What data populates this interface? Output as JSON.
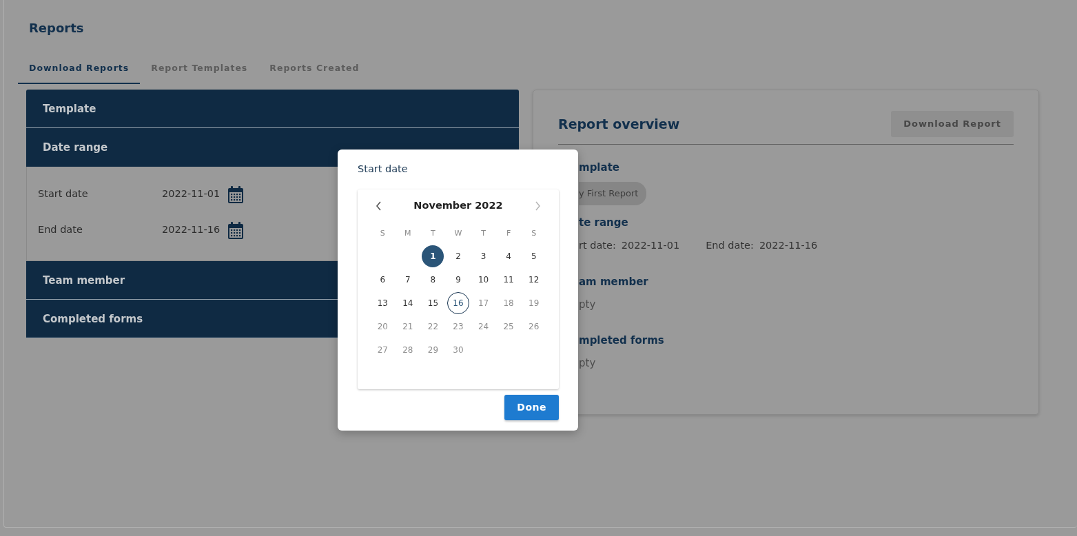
{
  "page": {
    "title": "Reports"
  },
  "tabs": [
    {
      "label": "Download Reports",
      "selected": true
    },
    {
      "label": "Report Templates",
      "selected": false
    },
    {
      "label": "Reports Created",
      "selected": false
    }
  ],
  "filters": [
    {
      "title": "Template",
      "expanded": false
    },
    {
      "title": "Date range",
      "expanded": true,
      "fields": [
        {
          "label": "Start date",
          "value": "2022-11-01"
        },
        {
          "label": "End date",
          "value": "2022-11-16"
        }
      ]
    },
    {
      "title": "Team member",
      "expanded": false
    },
    {
      "title": "Completed forms",
      "expanded": false
    }
  ],
  "overview": {
    "title": "Report overview",
    "download_button": {
      "label": "Download Report",
      "disabled": true
    },
    "sections": [
      {
        "kind": "tag",
        "heading": "mplate",
        "tag": "y First Report"
      },
      {
        "kind": "dates",
        "heading": "te range",
        "items": [
          {
            "label": "rt date:",
            "value": "2022-11-01"
          },
          {
            "label": "End date:",
            "value": "2022-11-16"
          }
        ]
      },
      {
        "kind": "empty",
        "heading": "am member",
        "text": "pty"
      },
      {
        "kind": "empty",
        "heading": "mpleted forms",
        "text": "pty"
      }
    ]
  },
  "datepicker": {
    "title": "Start date",
    "month": "November 2022",
    "prev_disabled": false,
    "next_disabled": true,
    "weekdays": [
      "S",
      "M",
      "T",
      "W",
      "T",
      "F",
      "S"
    ],
    "weeks": [
      [
        {
          "kind": "blank"
        },
        {
          "kind": "blank"
        },
        {
          "kind": "day",
          "label": "1",
          "selected": true,
          "outlined": false,
          "disabled": false
        },
        {
          "label": "2",
          "selected": false,
          "outlined": false,
          "disabled": false
        },
        {
          "label": "3",
          "selected": false,
          "outlined": false,
          "disabled": false
        },
        {
          "label": "4",
          "selected": false,
          "outlined": false,
          "disabled": false
        },
        {
          "label": "5",
          "selected": false,
          "outlined": false,
          "disabled": false
        }
      ],
      [
        {
          "label": "6",
          "selected": false,
          "outlined": false,
          "disabled": false
        },
        {
          "label": "7",
          "selected": false,
          "outlined": false,
          "disabled": false
        },
        {
          "label": "8",
          "selected": false,
          "outlined": false,
          "disabled": false
        },
        {
          "label": "9",
          "selected": false,
          "outlined": false,
          "disabled": false
        },
        {
          "label": "10",
          "selected": false,
          "outlined": false,
          "disabled": false
        },
        {
          "label": "11",
          "selected": false,
          "outlined": false,
          "disabled": false
        },
        {
          "label": "12",
          "selected": false,
          "outlined": false,
          "disabled": false
        }
      ],
      [
        {
          "label": "13",
          "selected": false,
          "outlined": false,
          "disabled": false
        },
        {
          "label": "14",
          "selected": false,
          "outlined": false,
          "disabled": false
        },
        {
          "label": "15",
          "selected": false,
          "outlined": false,
          "disabled": false
        },
        {
          "label": "16",
          "selected": false,
          "outlined": true,
          "disabled": false
        },
        {
          "label": "17",
          "selected": false,
          "outlined": false,
          "disabled": true
        },
        {
          "label": "18",
          "selected": false,
          "outlined": false,
          "disabled": true
        },
        {
          "label": "19",
          "selected": false,
          "outlined": false,
          "disabled": true
        }
      ],
      [
        {
          "label": "20",
          "selected": false,
          "outlined": false,
          "disabled": true
        },
        {
          "label": "21",
          "selected": false,
          "outlined": false,
          "disabled": true
        },
        {
          "label": "22",
          "selected": false,
          "outlined": false,
          "disabled": true
        },
        {
          "label": "23",
          "selected": false,
          "outlined": false,
          "disabled": true
        },
        {
          "label": "24",
          "selected": false,
          "outlined": false,
          "disabled": true
        },
        {
          "label": "25",
          "selected": false,
          "outlined": false,
          "disabled": true
        },
        {
          "label": "26",
          "selected": false,
          "outlined": false,
          "disabled": true
        }
      ],
      [
        {
          "label": "27",
          "selected": false,
          "outlined": false,
          "disabled": true
        },
        {
          "label": "28",
          "selected": false,
          "outlined": false,
          "disabled": true
        },
        {
          "label": "29",
          "selected": false,
          "outlined": false,
          "disabled": true
        },
        {
          "label": "30",
          "selected": false,
          "outlined": false,
          "disabled": true
        }
      ]
    ],
    "done_button": "Done"
  }
}
